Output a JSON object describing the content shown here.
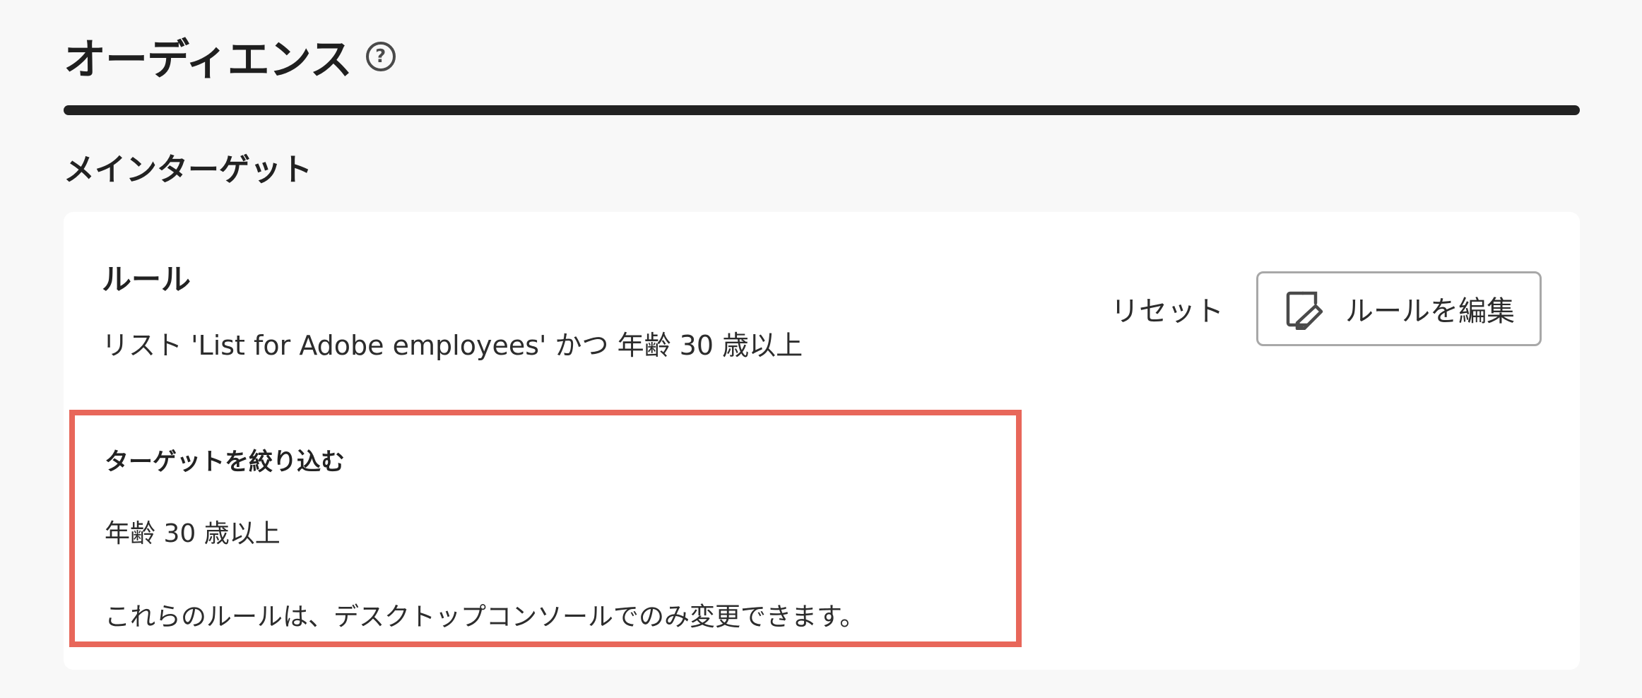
{
  "header": {
    "title": "オーディエンス",
    "help_icon": "help-circle-icon",
    "help_glyph": "?"
  },
  "main_target": {
    "section_title": "メインターゲット",
    "rule_card": {
      "label": "ルール",
      "rule_text": "リスト 'List for Adobe employees' かつ 年齢 30 歳以上",
      "actions": {
        "reset_label": "リセット",
        "edit_label": "ルールを編集",
        "edit_icon": "edit-icon"
      }
    },
    "refine": {
      "title": "ターゲットを絞り込む",
      "rule": "年齢 30 歳以上",
      "note": "これらのルールは、デスクトップコンソールでのみ変更できます。"
    }
  },
  "colors": {
    "background": "#f8f8f8",
    "card": "#ffffff",
    "divider": "#222222",
    "highlight_border": "#e8675a",
    "button_border": "#a8a8a8"
  }
}
